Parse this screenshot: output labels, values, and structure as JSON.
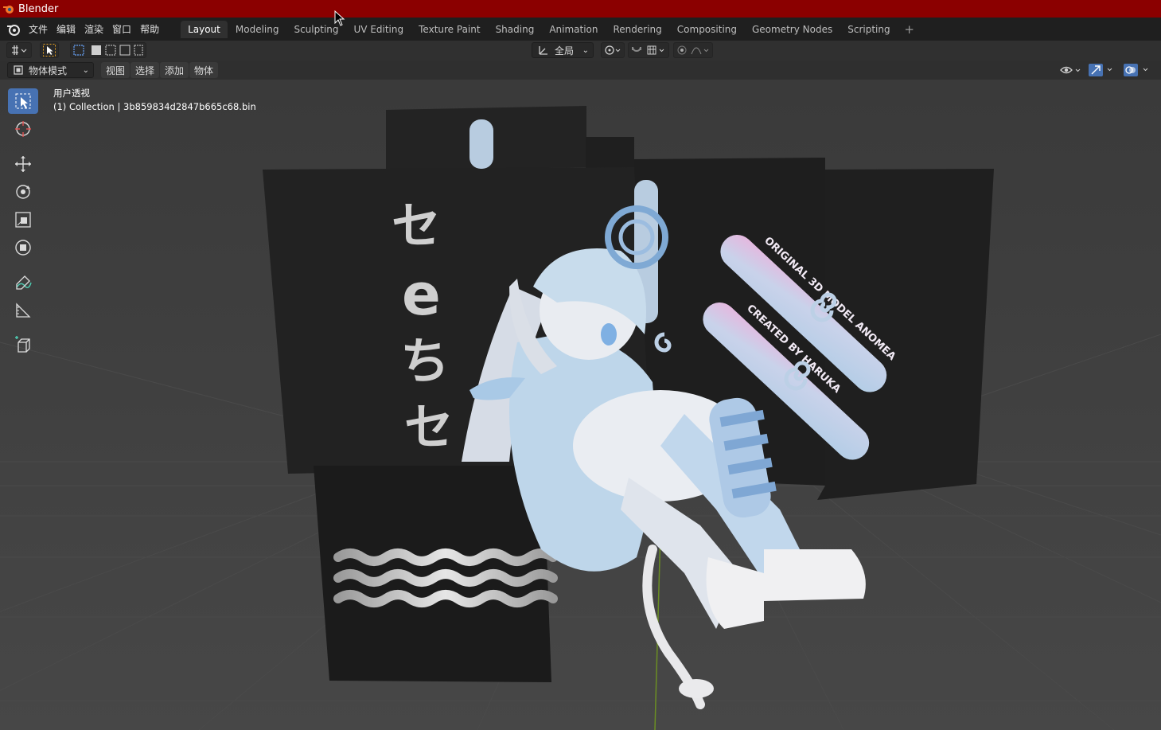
{
  "window": {
    "title": "Blender"
  },
  "menu": {
    "items": [
      "文件",
      "编辑",
      "渲染",
      "窗口",
      "帮助"
    ]
  },
  "workspaces": {
    "tabs": [
      "Layout",
      "Modeling",
      "Sculpting",
      "UV Editing",
      "Texture Paint",
      "Shading",
      "Animation",
      "Rendering",
      "Compositing",
      "Geometry Nodes",
      "Scripting"
    ],
    "active": "Layout",
    "add_label": "+"
  },
  "header": {
    "transform_orientation": "全局"
  },
  "viewport_header": {
    "mode": "物体模式",
    "menus": [
      "视图",
      "选择",
      "添加",
      "物体"
    ]
  },
  "viewport": {
    "view_name": "用户透视",
    "collection_info": "(1) Collection | 3b859834d2847b665c68.bin"
  },
  "scene": {
    "vertical_text_glyphs": [
      "セ",
      "e",
      "ち",
      "セ"
    ],
    "stick_texts": [
      "ORIGINAL 3D MODEL ANOMEA",
      "CREATED BY HARUKA"
    ]
  },
  "colors": {
    "title_bar": "#8b0000",
    "active_tool": "#4772b3",
    "panel_dark": "#1e1e1e",
    "character_blue": "#b9d3ea"
  }
}
